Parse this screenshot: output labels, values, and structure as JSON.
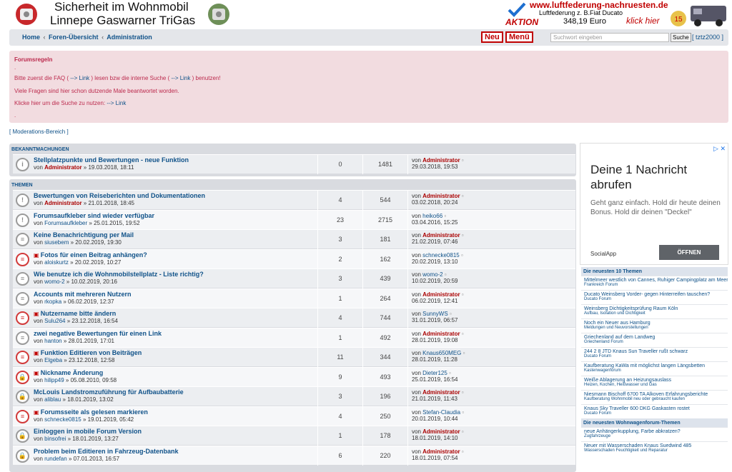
{
  "header": {
    "title_line1": "Sicherheit im Wohnmobil",
    "title_line2": "Linnepe Gaswarner TriGas"
  },
  "ad": {
    "url": "www.luftfederung-nachruesten.de",
    "line2": "Luftfederung z. B.Fiat Ducato",
    "aktion": "AKTION",
    "price": "348,19 Euro",
    "klick": "klick hier"
  },
  "nav": {
    "home": "Home",
    "forums": "Foren-Übersicht",
    "admin": "Administration",
    "sep": "‹",
    "new": "Neu",
    "menu": "Menü",
    "search_placeholder": "Suchwort eingeben",
    "search_btn": "Suche",
    "user": "[ tztz2000 ]"
  },
  "rules": {
    "title": "Forumsregeln",
    "dot": ".",
    "l1a": "Bitte zuerst die FAQ (",
    "l1b": "--> Link",
    "l1c": ") lesen bzw die interne Suche (",
    "l1d": "--> Link",
    "l1e": ") benutzen!",
    "l2": "Viele Fragen sind hier schon dutzende Male beantwortet worden.",
    "l3a": "Klicke hier um die Suche zu nutzen:",
    "l3b": "--> Link",
    "dot2": "."
  },
  "mod_link": "[ Moderations-Bereich ]",
  "announcements": {
    "header": "BEKANNTMACHUNGEN",
    "rows": [
      {
        "title": "Stellplatzpunkte und Bewertungen - neue Funktion",
        "by": "Administrator",
        "date": "19.03.2018, 18:11",
        "replies": "0",
        "views": "1481",
        "last_user": "Administrator",
        "last_date": "29.03.2018, 19:53",
        "admin": true,
        "last_admin": true,
        "icon": "i"
      }
    ]
  },
  "topics": {
    "header": "THEMEN",
    "rows": [
      {
        "title": "Bewertungen von Reiseberichten und Dokumentationen",
        "by": "Administrator",
        "date": "21.01.2018, 18:45",
        "replies": "4",
        "views": "544",
        "last_user": "Administrator",
        "last_date": "03.02.2018, 20:24",
        "admin": true,
        "last_admin": true,
        "icon": "!"
      },
      {
        "title": "Forumsaufkleber sind wieder verfügbar",
        "by": "Forumsaufkleber",
        "date": "25.01.2015, 19:52",
        "replies": "23",
        "views": "2715",
        "last_user": "heiko66",
        "last_date": "03.04.2016, 15:25",
        "icon": "!"
      },
      {
        "title": "Keine Benachrichtigung per Mail",
        "by": "siusebem",
        "date": "20.02.2019, 19:30",
        "replies": "3",
        "views": "181",
        "last_user": "Administrator",
        "last_date": "21.02.2019, 07:46",
        "last_admin": true,
        "icon": "="
      },
      {
        "title": "Fotos für einen Beitrag anhängen?",
        "by": "aloiskurtz",
        "date": "20.02.2019, 10:27",
        "replies": "2",
        "views": "162",
        "last_user": "schnecke0815",
        "last_date": "20.02.2019, 13:10",
        "red": true,
        "star": true,
        "icon": "="
      },
      {
        "title": "Wie benutze ich die Wohnmobilstellplatz - Liste richtig?",
        "by": "womo-2",
        "date": "10.02.2019, 20:16",
        "replies": "3",
        "views": "439",
        "last_user": "womo-2",
        "last_date": "10.02.2019, 20:59",
        "icon": "="
      },
      {
        "title": "Accounts mit mehreren Nutzern",
        "by": "rkopka",
        "date": "06.02.2019, 12:37",
        "replies": "1",
        "views": "264",
        "last_user": "Administrator",
        "last_date": "06.02.2019, 12:41",
        "last_admin": true,
        "icon": "="
      },
      {
        "title": "Nutzername bitte ändern",
        "by": "Sulu264",
        "date": "23.12.2018, 16:54",
        "replies": "4",
        "views": "744",
        "last_user": "SunnyWS",
        "last_date": "31.01.2019, 06:57",
        "red": true,
        "star": true,
        "icon": "="
      },
      {
        "title": "zwei negative Bewertungen für einen Link",
        "by": "hanton",
        "date": "28.01.2019, 17:01",
        "replies": "1",
        "views": "492",
        "last_user": "Administrator",
        "last_date": "28.01.2019, 19:08",
        "last_admin": true,
        "icon": "="
      },
      {
        "title": "Funktion Editieren von Beiträgen",
        "by": "Elgeba",
        "date": "23.12.2018, 12:58",
        "replies": "11",
        "views": "344",
        "last_user": "Knaus650MEG",
        "last_date": "28.01.2019, 11:28",
        "red": true,
        "star": true,
        "icon": "="
      },
      {
        "title": "Nickname Änderung",
        "by": "hilipp49",
        "date": "05.08.2010, 09:58",
        "replies": "9",
        "views": "493",
        "last_user": "Dieter125",
        "last_date": "25.01.2019, 16:54",
        "red": true,
        "star": true,
        "icon": "L"
      },
      {
        "title": "McLouis Landstromzuführung für Aufbaubatterie",
        "by": "aliblau",
        "date": "18.01.2019, 13:02",
        "replies": "3",
        "views": "196",
        "last_user": "Administrator",
        "last_date": "21.01.2019, 11:43",
        "last_admin": true,
        "icon": "L"
      },
      {
        "title": "Forumsseite als gelesen markieren",
        "by": "schnecke0815",
        "date": "19.01.2019, 05:42",
        "replies": "4",
        "views": "250",
        "last_user": "Stefan-Claudia",
        "last_date": "20.01.2019, 10:44",
        "red": true,
        "star": true,
        "icon": "="
      },
      {
        "title": "Einloggen in mobile Forum Version",
        "by": "binsofrei",
        "date": "18.01.2019, 13:27",
        "replies": "1",
        "views": "178",
        "last_user": "Administrator",
        "last_date": "18.01.2019, 14:10",
        "last_admin": true,
        "icon": "L"
      },
      {
        "title": "Problem beim Editieren in Fahrzeug-Datenbank",
        "by": "rundefan",
        "date": "07.01.2013, 16:57",
        "replies": "6",
        "views": "220",
        "last_user": "Administrator",
        "last_date": "18.01.2019, 07:54",
        "last_admin": true,
        "icon": "L"
      }
    ]
  },
  "side_ad": {
    "headline": "Deine 1 Nachricht abrufen",
    "body": "Geht ganz einfach. Hold dir heute deinen Bonus. Hold dir deinen \"Deckel\"",
    "source": "SocialApp",
    "open": "ÖFFNEN",
    "close": "▷ ✕"
  },
  "side_latest": {
    "header": "Die neuesten 10 Themen",
    "items": [
      {
        "t": "Mittelmeer westlich von Cannes, Ruhiger Campingplatz am Meer",
        "f": "Frankreich Forum"
      },
      {
        "t": "Ducato Weinsberg Vorder- gegen Hinterreifen tauschen?",
        "f": "Ducato Forum"
      },
      {
        "t": "Weinsberg Dichtigkeitsprüfung Raum Köln",
        "f": "Aufbau, Isolation und Dichtigkeit"
      },
      {
        "t": "Noch ein Neuer aus Hamburg",
        "f": "Meldungen und Neuvorstellungen"
      },
      {
        "t": "Griechenland auf dem Landweg",
        "f": "Griechenland Forum"
      },
      {
        "t": "244 2 8 JTD Knaus Sun Traveller rußt schwarz",
        "f": "Ducato Forum"
      },
      {
        "t": "Kaufberatung KaWa mit möglichst langen Längsbetten",
        "f": "Kastenwagenforum"
      },
      {
        "t": "Weiße Ablagerung an Heizungsauslass",
        "f": "Heizen, Kochen, Heißwasser und Gas"
      },
      {
        "t": "Niesmann Bischoff 6700 TA Alkoven Erfahrungsberichte",
        "f": "Kaufberatung Wohnmobil neu oder gebraucht kaufen"
      },
      {
        "t": "Knaus Sky Traveller 600 DKG Gaskasten rostet",
        "f": "Ducato Forum"
      }
    ]
  },
  "side_wf": {
    "header": "Die neuesten Wohnwagenforum-Themen",
    "items": [
      {
        "t": "neue Anhängerkupplung, Farbe abkratzen?",
        "f": "Zugfahrzeuge"
      },
      {
        "t": "Neuer mit Wasserschaden Knaus Suedwind 485",
        "f": "Wasserschaden Feuchtigkeit und Reparatur"
      }
    ]
  }
}
